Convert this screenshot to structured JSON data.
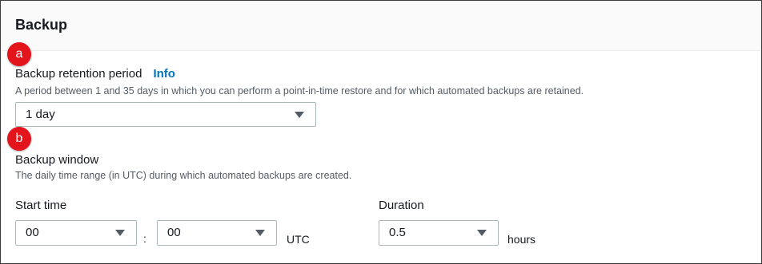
{
  "section": {
    "title": "Backup"
  },
  "badges": {
    "a": "a",
    "b": "b"
  },
  "retention": {
    "label": "Backup retention period",
    "info_link": "Info",
    "description": "A period between 1 and 35 days in which you can perform a point-in-time restore and for which automated backups are retained.",
    "selected": "1 day"
  },
  "backup_window": {
    "label": "Backup window",
    "description": "The daily time range (in UTC) during which automated backups are created.",
    "start_time": {
      "label": "Start time",
      "hour": "00",
      "separator": ":",
      "minute": "00",
      "suffix": "UTC"
    },
    "duration": {
      "label": "Duration",
      "value": "0.5",
      "suffix": "hours"
    }
  },
  "colors": {
    "badge": "#e3141b",
    "link": "#0073bb",
    "border": "#aab7b8",
    "header_bg": "#fafafa"
  },
  "icons": {
    "dropdown": "caret-down-icon"
  }
}
